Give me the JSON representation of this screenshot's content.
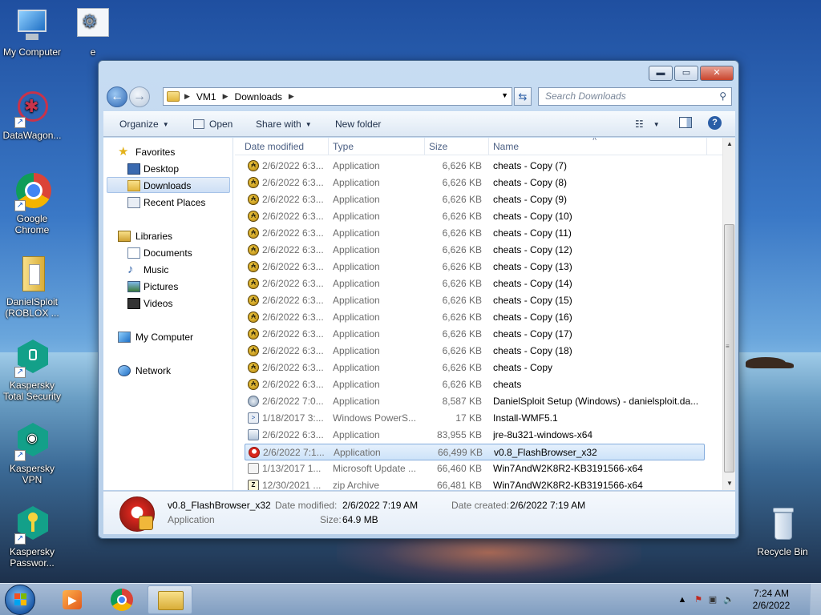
{
  "desktop": {
    "icons": [
      {
        "label": "My Computer"
      },
      {
        "label": "e"
      },
      {
        "label": "DataWagon..."
      },
      {
        "label": "Google Chrome"
      },
      {
        "label": "DanielSploit (ROBLOX ..."
      },
      {
        "label": "Kaspersky Total Security"
      },
      {
        "label": "Kaspersky VPN"
      },
      {
        "label": "Kaspersky Passwor..."
      },
      {
        "label": "Recycle Bin"
      }
    ]
  },
  "window": {
    "buttons": {
      "minimize": "▬",
      "maximize": "▭",
      "close": "✕"
    },
    "address": {
      "crumbs": [
        "VM1",
        "Downloads"
      ]
    },
    "search": {
      "placeholder": "Search Downloads"
    },
    "toolbar": {
      "organize": "Organize",
      "open": "Open",
      "share_with": "Share with",
      "new_folder": "New folder"
    },
    "navpane": {
      "favorites": "Favorites",
      "desktop": "Desktop",
      "downloads": "Downloads",
      "recent_places": "Recent Places",
      "libraries": "Libraries",
      "documents": "Documents",
      "music": "Music",
      "pictures": "Pictures",
      "videos": "Videos",
      "my_computer": "My Computer",
      "network": "Network"
    },
    "columns": {
      "date_modified": "Date modified",
      "type": "Type",
      "size": "Size",
      "name": "Name"
    },
    "files": [
      {
        "date": "2/6/2022 6:3...",
        "type": "Application",
        "size": "6,626 KB",
        "name": "cheats - Copy (7)",
        "icon": "cheat-app-icon"
      },
      {
        "date": "2/6/2022 6:3...",
        "type": "Application",
        "size": "6,626 KB",
        "name": "cheats - Copy (8)",
        "icon": "cheat-app-icon"
      },
      {
        "date": "2/6/2022 6:3...",
        "type": "Application",
        "size": "6,626 KB",
        "name": "cheats - Copy (9)",
        "icon": "cheat-app-icon"
      },
      {
        "date": "2/6/2022 6:3...",
        "type": "Application",
        "size": "6,626 KB",
        "name": "cheats - Copy (10)",
        "icon": "cheat-app-icon"
      },
      {
        "date": "2/6/2022 6:3...",
        "type": "Application",
        "size": "6,626 KB",
        "name": "cheats - Copy (11)",
        "icon": "cheat-app-icon"
      },
      {
        "date": "2/6/2022 6:3...",
        "type": "Application",
        "size": "6,626 KB",
        "name": "cheats - Copy (12)",
        "icon": "cheat-app-icon"
      },
      {
        "date": "2/6/2022 6:3...",
        "type": "Application",
        "size": "6,626 KB",
        "name": "cheats - Copy (13)",
        "icon": "cheat-app-icon"
      },
      {
        "date": "2/6/2022 6:3...",
        "type": "Application",
        "size": "6,626 KB",
        "name": "cheats - Copy (14)",
        "icon": "cheat-app-icon"
      },
      {
        "date": "2/6/2022 6:3...",
        "type": "Application",
        "size": "6,626 KB",
        "name": "cheats - Copy (15)",
        "icon": "cheat-app-icon"
      },
      {
        "date": "2/6/2022 6:3...",
        "type": "Application",
        "size": "6,626 KB",
        "name": "cheats - Copy (16)",
        "icon": "cheat-app-icon"
      },
      {
        "date": "2/6/2022 6:3...",
        "type": "Application",
        "size": "6,626 KB",
        "name": "cheats - Copy (17)",
        "icon": "cheat-app-icon"
      },
      {
        "date": "2/6/2022 6:3...",
        "type": "Application",
        "size": "6,626 KB",
        "name": "cheats - Copy (18)",
        "icon": "cheat-app-icon"
      },
      {
        "date": "2/6/2022 6:3...",
        "type": "Application",
        "size": "6,626 KB",
        "name": "cheats - Copy",
        "icon": "cheat-app-icon"
      },
      {
        "date": "2/6/2022 6:3...",
        "type": "Application",
        "size": "6,626 KB",
        "name": "cheats",
        "icon": "cheat-app-icon"
      },
      {
        "date": "2/6/2022 7:0...",
        "type": "Application",
        "size": "8,587 KB",
        "name": "DanielSploit Setup (Windows) - danielsploit.da...",
        "icon": "setup-icon"
      },
      {
        "date": "1/18/2017 3:...",
        "type": "Windows PowerS...",
        "size": "17 KB",
        "name": "Install-WMF5.1",
        "icon": "powershell-script-icon"
      },
      {
        "date": "2/6/2022 6:3...",
        "type": "Application",
        "size": "83,955 KB",
        "name": "jre-8u321-windows-x64",
        "icon": "java-installer-icon"
      },
      {
        "date": "2/6/2022 7:1...",
        "type": "Application",
        "size": "66,499 KB",
        "name": "v0.8_FlashBrowser_x32",
        "icon": "flash-browser-icon",
        "selected": true
      },
      {
        "date": "1/13/2017 1...",
        "type": "Microsoft Update ...",
        "size": "66,460 KB",
        "name": "Win7AndW2K8R2-KB3191566-x64",
        "icon": "update-package-icon"
      },
      {
        "date": "12/30/2021 ...",
        "type": "zip Archive",
        "size": "66,481 KB",
        "name": "Win7AndW2K8R2-KB3191566-x64",
        "icon": "zip-archive-icon"
      }
    ],
    "details": {
      "name": "v0.8_FlashBrowser_x32",
      "type": "Application",
      "date_modified_label": "Date modified:",
      "date_modified": "2/6/2022 7:19 AM",
      "date_created_label": "Date created:",
      "date_created": "2/6/2022 7:19 AM",
      "size_label": "Size:",
      "size": "64.9 MB"
    }
  },
  "taskbar": {
    "time": "7:24 AM",
    "date": "2/6/2022"
  }
}
